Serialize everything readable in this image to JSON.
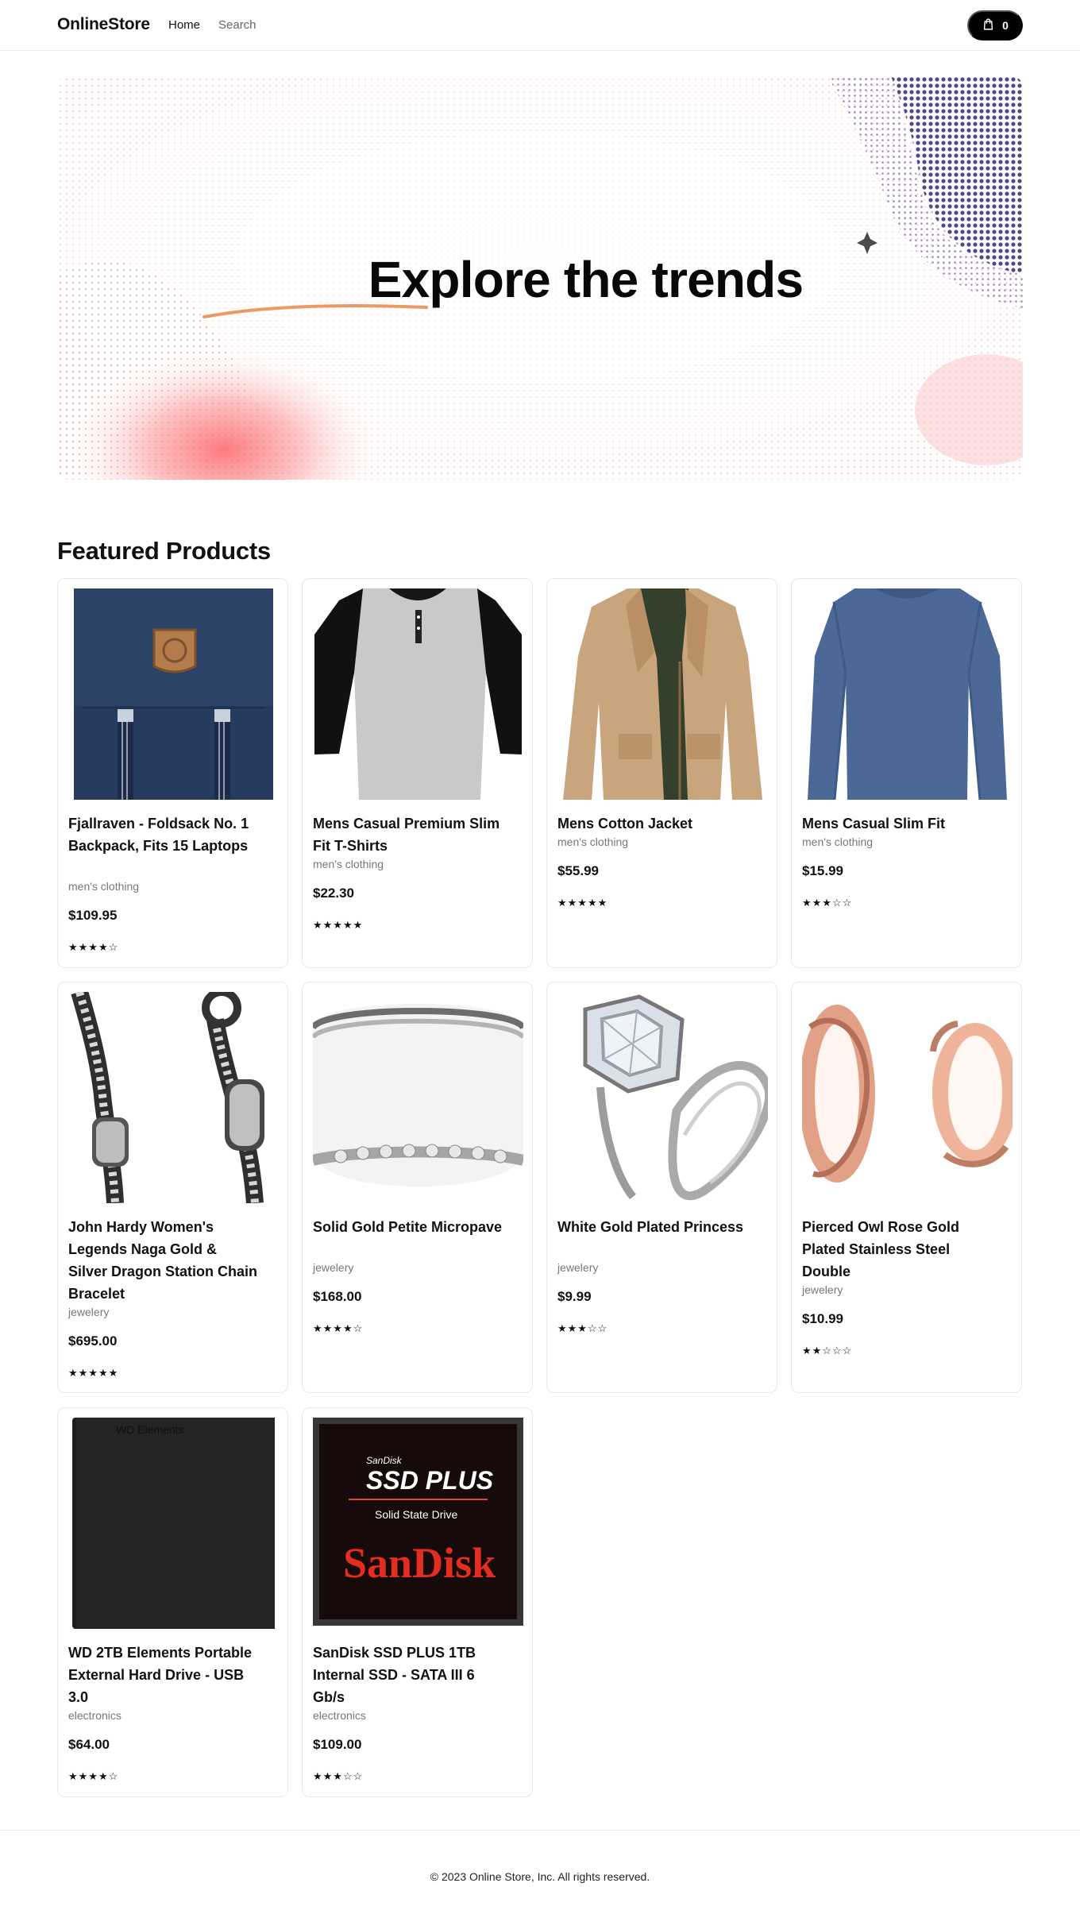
{
  "header": {
    "logo": "OnlineStore",
    "nav": [
      {
        "label": "Home"
      },
      {
        "label": "Search"
      }
    ],
    "cart_count": "0",
    "cart_icon": "shopping-bag-icon"
  },
  "hero": {
    "title": "Explore the trends",
    "colors": {
      "pink": "#f7a2a4",
      "purple": "#57478a",
      "underline": "#ec9966"
    }
  },
  "featured": {
    "title": "Featured Products",
    "products": [
      {
        "title": "Fjallraven - Foldsack No. 1 Backpack, Fits 15 Laptops",
        "category": "men's clothing",
        "price": "$109.95",
        "rating": "★★★★☆",
        "rating_value": 4
      },
      {
        "title": "Mens Casual Premium Slim Fit T-Shirts",
        "category": "men's clothing",
        "price": "$22.30",
        "rating": "★★★★★",
        "rating_value": 5
      },
      {
        "title": "Mens Cotton Jacket",
        "category": "men's clothing",
        "price": "$55.99",
        "rating": "★★★★★",
        "rating_value": 5
      },
      {
        "title": "Mens Casual Slim Fit",
        "category": "men's clothing",
        "price": "$15.99",
        "rating": "★★★☆☆",
        "rating_value": 3
      },
      {
        "title": "John Hardy Women's Legends Naga Gold & Silver Dragon Station Chain Bracelet",
        "category": "jewelery",
        "price": "$695.00",
        "rating": "★★★★★",
        "rating_value": 5
      },
      {
        "title": "Solid Gold Petite Micropave",
        "category": "jewelery",
        "price": "$168.00",
        "rating": "★★★★☆",
        "rating_value": 4
      },
      {
        "title": "White Gold Plated Princess",
        "category": "jewelery",
        "price": "$9.99",
        "rating": "★★★☆☆",
        "rating_value": 3
      },
      {
        "title": "Pierced Owl Rose Gold Plated Stainless Steel Double",
        "category": "jewelery",
        "price": "$10.99",
        "rating": "★★☆☆☆",
        "rating_value": 2
      },
      {
        "title": "WD 2TB Elements Portable External Hard Drive - USB 3.0",
        "category": "electronics",
        "price": "$64.00",
        "rating": "★★★★☆",
        "rating_value": 4,
        "image_text": "WD Elements"
      },
      {
        "title": "SanDisk SSD PLUS 1TB Internal SSD - SATA III 6 Gb/s",
        "category": "electronics",
        "price": "$109.00",
        "rating": "★★★☆☆",
        "rating_value": 3,
        "image_text": {
          "brand": "SanDisk",
          "product": "SSD PLUS",
          "subtitle": "Solid State Drive",
          "logo": "SanDisk"
        }
      }
    ]
  },
  "footer": {
    "text": "© 2023 Online Store, Inc. All rights reserved."
  }
}
